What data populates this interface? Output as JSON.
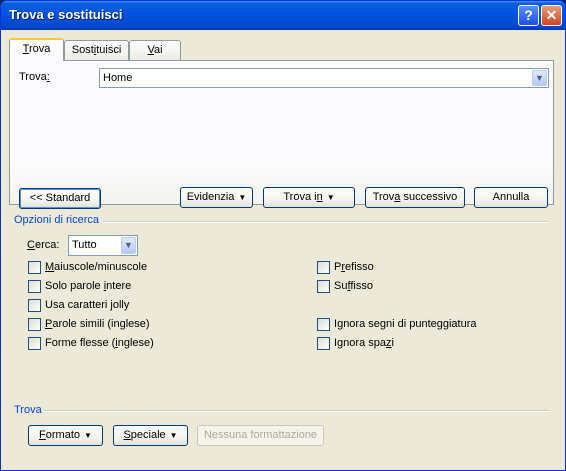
{
  "window": {
    "title": "Trova e sostituisci",
    "help_label": "?",
    "close_label": "✕"
  },
  "tabs": [
    {
      "pre": "",
      "acc": "T",
      "post": "rova"
    },
    {
      "pre": "Sost",
      "acc": "i",
      "post": "tuisci"
    },
    {
      "pre": "",
      "acc": "V",
      "post": "ai"
    }
  ],
  "find": {
    "label_pre": "Trova",
    "label_acc": ":",
    "value": "Home"
  },
  "buttons": {
    "standard": "<< Standard",
    "highlight": "Evidenzia",
    "find_in_pre": "Trova i",
    "find_in_acc": "n",
    "find_in_post": "",
    "find_next_pre": "Trov",
    "find_next_acc": "a",
    "find_next_post": " successivo",
    "cancel": "Annulla"
  },
  "search_options": {
    "heading": "Opzioni di ricerca",
    "search_label_acc": "C",
    "search_label_post": "erca:",
    "search_value": "Tutto",
    "left": [
      {
        "pre": "",
        "acc": "M",
        "post": "aiuscole/minuscole"
      },
      {
        "pre": "Solo parole ",
        "acc": "i",
        "post": "ntere"
      },
      {
        "pre": "Usa caratteri ",
        "acc": "j",
        "post": "olly"
      },
      {
        "pre": "",
        "acc": "P",
        "post": "arole simili (inglese)"
      },
      {
        "pre": "Forme flesse (",
        "acc": "i",
        "post": "nglese)"
      }
    ],
    "right": [
      {
        "pre": "P",
        "acc": "r",
        "post": "efisso"
      },
      {
        "pre": "Su",
        "acc": "f",
        "post": "fisso"
      },
      {
        "pre": "I",
        "acc": "g",
        "post": "nora segni di punteggiatura"
      },
      {
        "pre": "Ignora spa",
        "acc": "z",
        "post": "i"
      }
    ]
  },
  "footer": {
    "heading": "Trova",
    "format_acc": "F",
    "format_post": "ormato",
    "special_acc": "S",
    "special_post": "peciale",
    "no_format": "Nessuna formattazione"
  },
  "colors": {
    "title_bar": "#0054e3",
    "dialog_bg": "#ece9d8",
    "group_label": "#0046d5"
  }
}
